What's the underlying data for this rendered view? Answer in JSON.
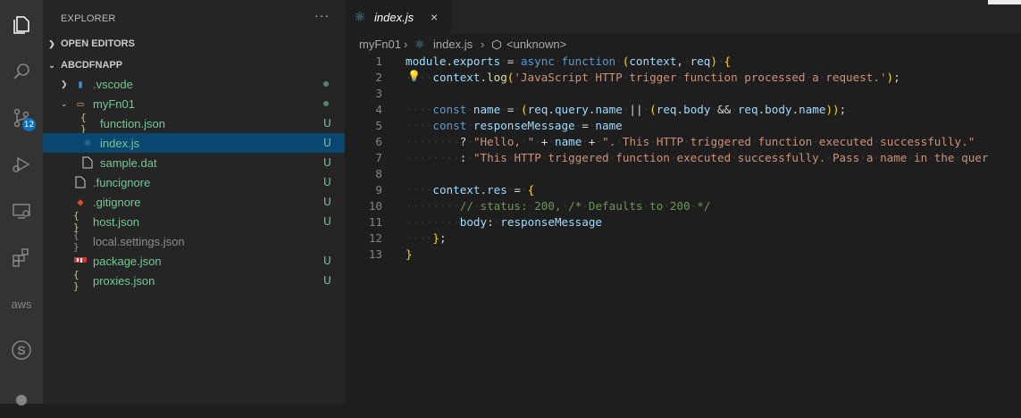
{
  "activity_bar": {
    "icons": [
      "explorer-icon",
      "search-icon",
      "source-control-icon",
      "run-debug-icon",
      "remote-explorer-icon",
      "extensions-icon",
      "aws-icon",
      "s-icon",
      "more-icon"
    ],
    "scm_badge": "12",
    "aws_label": "aws",
    "s_label": "S"
  },
  "sidebar": {
    "title": "EXPLORER",
    "more": "···",
    "open_editors": "OPEN EDITORS",
    "project": "ABCDFNAPP",
    "items": [
      {
        "label": ".vscode",
        "status": "dot",
        "icon": "folder-vscode-icon",
        "glyph": "▮"
      },
      {
        "label": "myFn01",
        "status": "dot",
        "icon": "folder-open-icon",
        "glyph": "▭"
      },
      {
        "label": "function.json",
        "status": "U",
        "icon": "json-icon",
        "glyph": "{ }"
      },
      {
        "label": "index.js",
        "status": "U",
        "icon": "react-icon",
        "glyph": "⚛"
      },
      {
        "label": "sample.dat",
        "status": "U",
        "icon": "file-icon",
        "glyph": "🗋"
      },
      {
        "label": ".funcignore",
        "status": "U",
        "icon": "file-icon",
        "glyph": "🗋"
      },
      {
        "label": ".gitignore",
        "status": "U",
        "icon": "git-icon",
        "glyph": "◆"
      },
      {
        "label": "host.json",
        "status": "U",
        "icon": "json-icon",
        "glyph": "{ }"
      },
      {
        "label": "local.settings.json",
        "status": "",
        "icon": "json-icon",
        "glyph": "{ }"
      },
      {
        "label": "package.json",
        "status": "U",
        "icon": "npm-icon",
        "glyph": "▬"
      },
      {
        "label": "proxies.json",
        "status": "U",
        "icon": "json-icon",
        "glyph": "{ }"
      }
    ]
  },
  "tab": {
    "label": "index.js",
    "close": "×"
  },
  "breadcrumb": {
    "folder": "myFn01",
    "sep": "›",
    "file": "index.js",
    "symbol": "<unknown>"
  },
  "editor": {
    "line_numbers": [
      "1",
      "2",
      "3",
      "4",
      "5",
      "6",
      "7",
      "8",
      "9",
      "10",
      "11",
      "12",
      "13"
    ],
    "lines": [
      "module.exports = async function (context, req) {",
      "    context.log('JavaScript HTTP trigger function processed a request.');",
      "",
      "    const name = (req.query.name || (req.body && req.body.name));",
      "    const responseMessage = name",
      "        ? \"Hello, \" + name + \". This HTTP triggered function executed successfully.\"",
      "        : \"This HTTP triggered function executed successfully. Pass a name in the quer",
      "",
      "    context.res = {",
      "        // status: 200, /* Defaults to 200 */",
      "        body: responseMessage",
      "    };",
      "}"
    ]
  }
}
